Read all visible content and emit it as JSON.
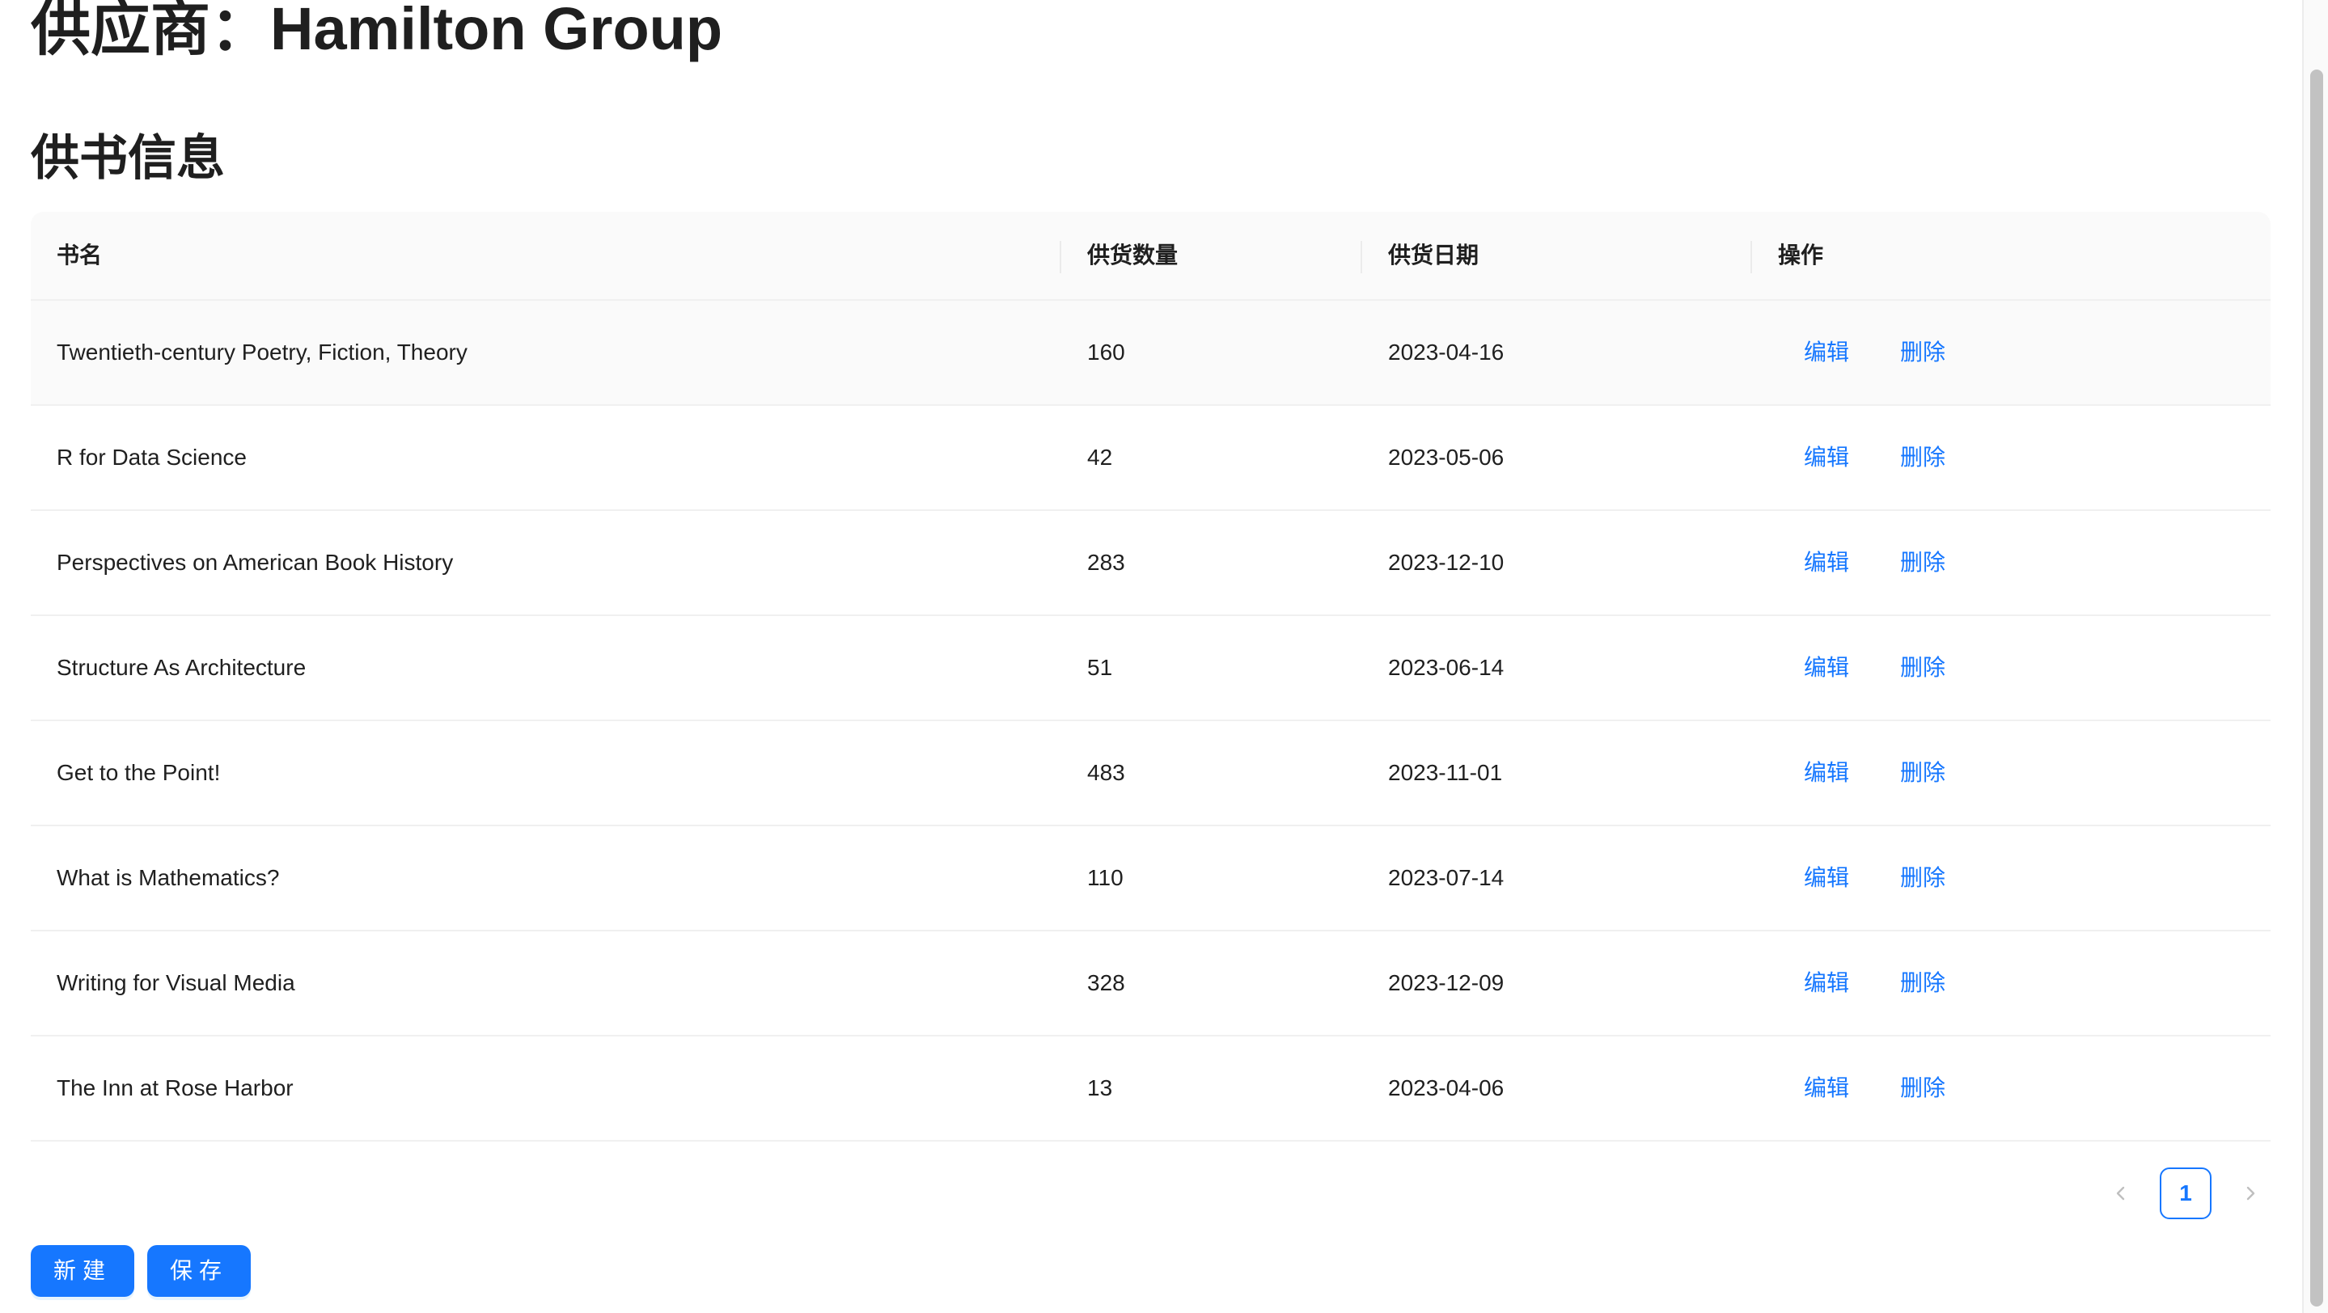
{
  "supplier": {
    "label": "供应商：",
    "name": "Hamilton Group"
  },
  "section": {
    "title": "供书信息"
  },
  "table": {
    "columns": [
      "书名",
      "供货数量",
      "供货日期",
      "操作"
    ],
    "action_labels": {
      "edit": "编辑",
      "delete": "删除"
    },
    "rows": [
      {
        "title": "Twentieth-century Poetry, Fiction, Theory",
        "quantity": "160",
        "date": "2023-04-16"
      },
      {
        "title": "R for Data Science",
        "quantity": "42",
        "date": "2023-05-06"
      },
      {
        "title": "Perspectives on American Book History",
        "quantity": "283",
        "date": "2023-12-10"
      },
      {
        "title": "Structure As Architecture",
        "quantity": "51",
        "date": "2023-06-14"
      },
      {
        "title": "Get to the Point!",
        "quantity": "483",
        "date": "2023-11-01"
      },
      {
        "title": "What is Mathematics?",
        "quantity": "110",
        "date": "2023-07-14"
      },
      {
        "title": "Writing for Visual Media",
        "quantity": "328",
        "date": "2023-12-09"
      },
      {
        "title": "The Inn at Rose Harbor",
        "quantity": "13",
        "date": "2023-04-06"
      }
    ]
  },
  "pagination": {
    "current_page": "1",
    "prev_icon": "chevron-left-icon",
    "next_icon": "chevron-right-icon"
  },
  "buttons": {
    "new_label": "新建",
    "save_label": "保存"
  },
  "colors": {
    "accent": "#1677ff",
    "header_bg": "#fafafa"
  }
}
